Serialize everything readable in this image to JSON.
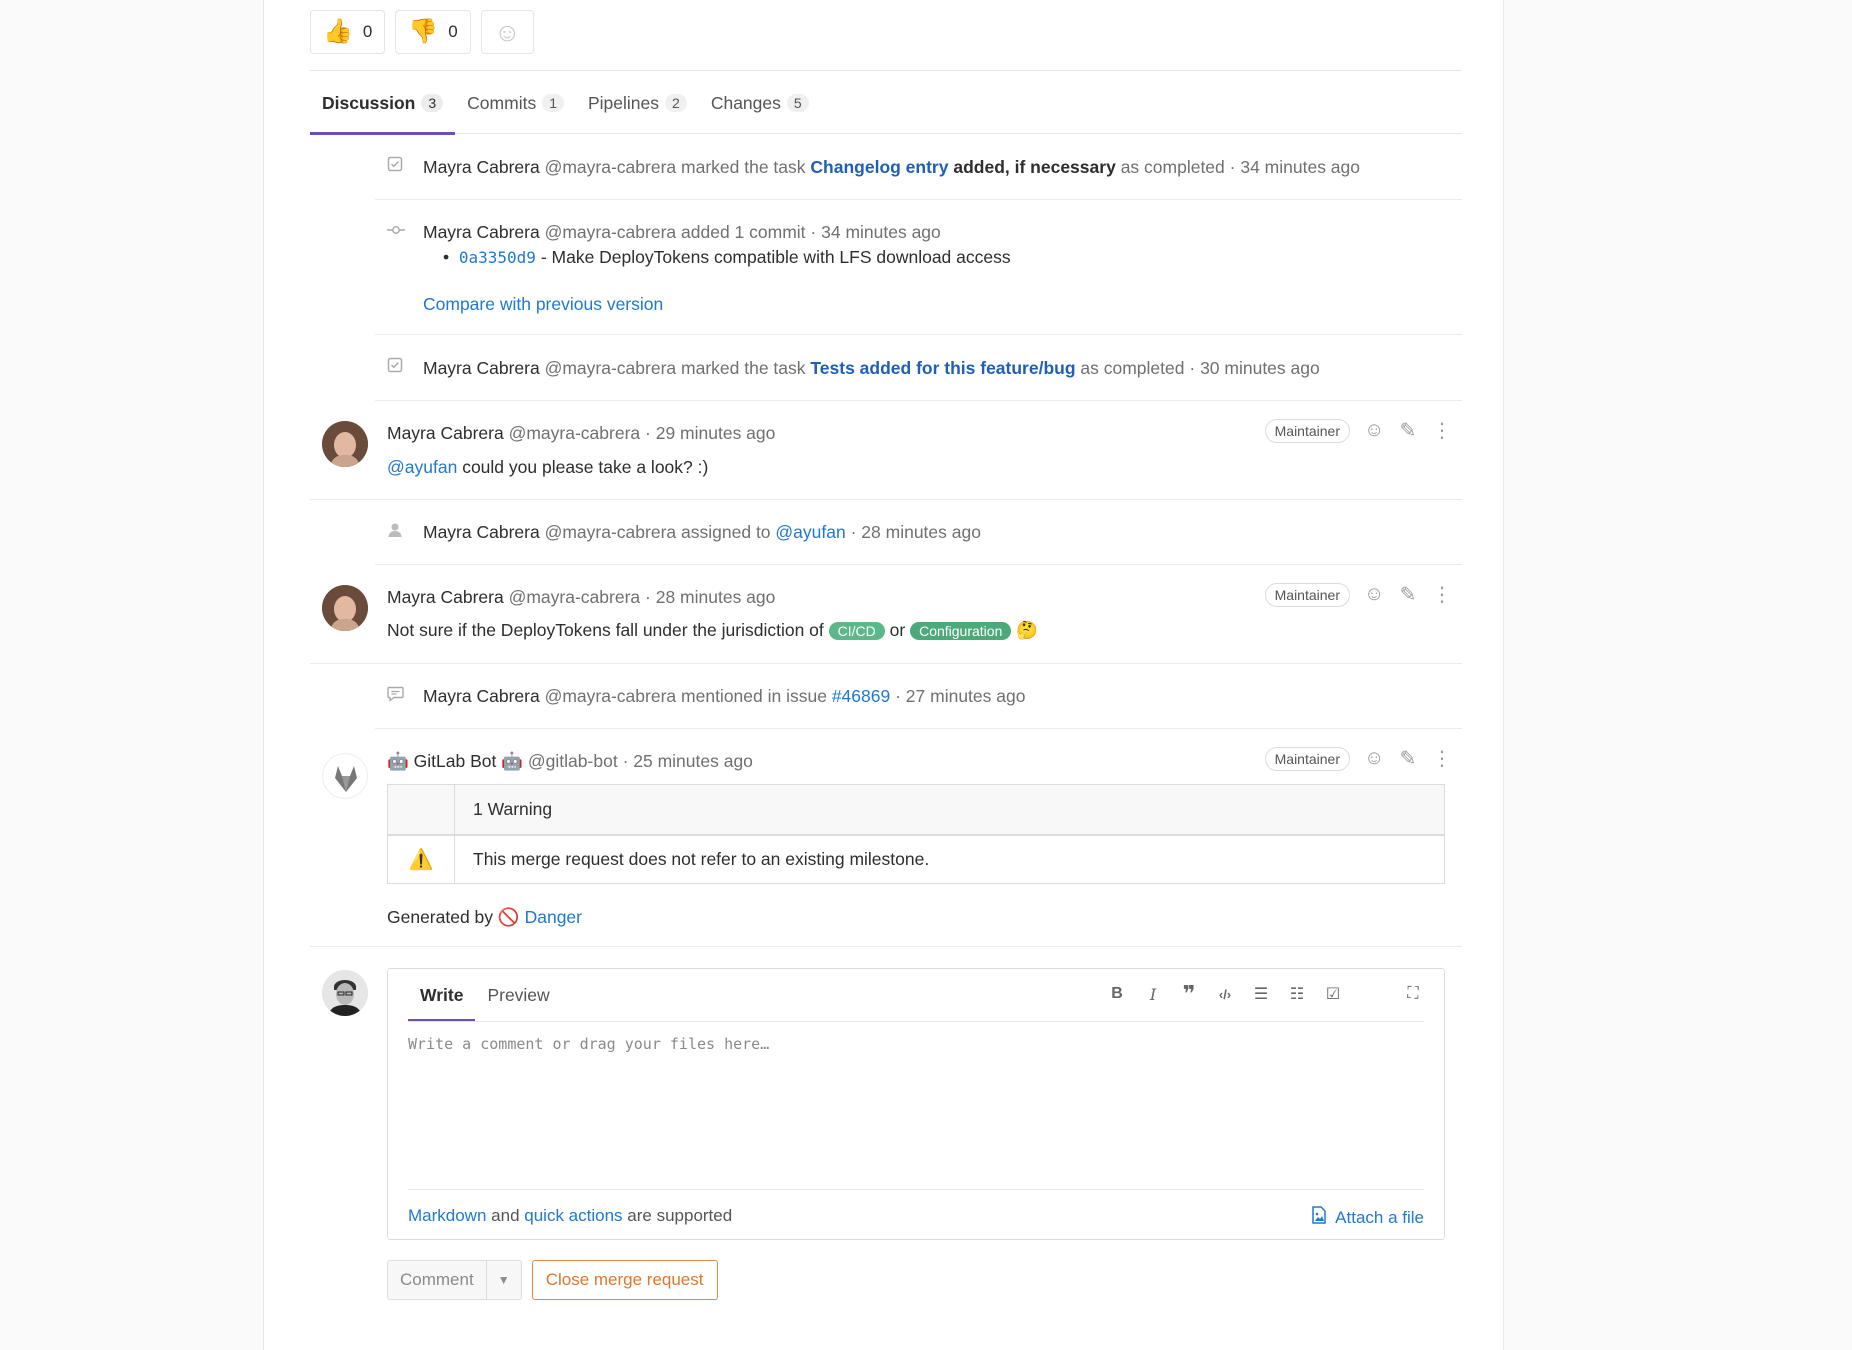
{
  "awards": {
    "thumbsup": {
      "emoji": "👍",
      "count": "0"
    },
    "thumbsdown": {
      "emoji": "👎",
      "count": "0"
    },
    "add_icon": "smiley-icon"
  },
  "tabs": [
    {
      "label": "Discussion",
      "count": "3"
    },
    {
      "label": "Commits",
      "count": "1"
    },
    {
      "label": "Pipelines",
      "count": "2"
    },
    {
      "label": "Changes",
      "count": "5"
    }
  ],
  "notes": {
    "task1": {
      "author": "Mayra Cabrera",
      "handle": "@mayra-cabrera",
      "action": "marked the task",
      "task_link": "Changelog entry",
      "task_rest": "added, if necessary",
      "suffix": "as completed",
      "time": "· 34 minutes ago"
    },
    "commit": {
      "author": "Mayra Cabrera",
      "handle": "@mayra-cabrera",
      "action": "added 1 commit",
      "time": "· 34 minutes ago",
      "sha": "0a3350d9",
      "message": "- Make DeployTokens compatible with LFS download access",
      "compare": "Compare with previous version"
    },
    "task2": {
      "author": "Mayra Cabrera",
      "handle": "@mayra-cabrera",
      "action": "marked the task",
      "task_link": "Tests added for this feature/bug",
      "suffix": "as completed",
      "time": "· 30 minutes ago"
    },
    "comment1": {
      "author": "Mayra Cabrera",
      "handle": "@mayra-cabrera",
      "time": "· 29 minutes ago",
      "role": "Maintainer",
      "mention": "@ayufan",
      "text": "could you please take a look? :)"
    },
    "assign": {
      "author": "Mayra Cabrera",
      "handle": "@mayra-cabrera",
      "action": "assigned to",
      "assignee": "@ayufan",
      "time": "· 28 minutes ago"
    },
    "comment2": {
      "author": "Mayra Cabrera",
      "handle": "@mayra-cabrera",
      "time": "· 28 minutes ago",
      "role": "Maintainer",
      "text_before": "Not sure if the DeployTokens fall under the jurisdiction of",
      "label1": "CI/CD",
      "or": "or",
      "label2": "Configuration",
      "emoji": "🤔"
    },
    "mention": {
      "author": "Mayra Cabrera",
      "handle": "@mayra-cabrera",
      "action": "mentioned in issue",
      "issue": "#46869",
      "time": "· 27 minutes ago"
    },
    "bot": {
      "author": "GitLab Bot",
      "handle": "@gitlab-bot",
      "time": "· 25 minutes ago",
      "role": "Maintainer",
      "robot_emoji": "🤖",
      "table_header": "1 Warning",
      "warning_icon": "⚠️",
      "warning_text": "This merge request does not refer to an existing milestone.",
      "generated_by": "Generated by",
      "danger_icon": "🚫",
      "danger_link": "Danger"
    }
  },
  "form": {
    "tab_write": "Write",
    "tab_preview": "Preview",
    "toolbar": [
      "B",
      "I",
      "❞",
      "‹/›",
      "☰",
      "☷",
      "☑",
      "⛶"
    ],
    "placeholder": "Write a comment or drag your files here…",
    "markdown_link": "Markdown",
    "and": "and",
    "quick_actions_link": "quick actions",
    "supported": "are supported",
    "attach": "Attach a file",
    "comment_button": "Comment",
    "close_button": "Close merge request"
  }
}
